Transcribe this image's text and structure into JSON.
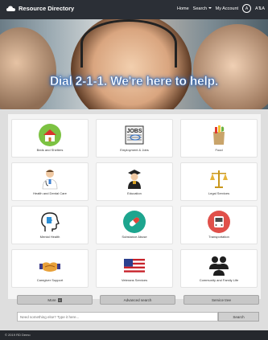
{
  "navbar": {
    "brand": "Resource Directory",
    "home": "Home",
    "search": "Search",
    "account": "My Account",
    "accessibility_text": "A",
    "font_size_text": "A⇅A"
  },
  "hero": {
    "title": "Dial 2-1-1. We're here to help."
  },
  "categories": [
    {
      "label": "Beds and Shelters",
      "icon": "house-icon"
    },
    {
      "label": "Employment & Jobs",
      "icon": "jobs-newspaper-icon"
    },
    {
      "label": "Food",
      "icon": "grocery-bag-icon"
    },
    {
      "label": "Health and Dental Care",
      "icon": "doctor-icon"
    },
    {
      "label": "Education",
      "icon": "graduate-icon"
    },
    {
      "label": "Legal Services",
      "icon": "scales-icon"
    },
    {
      "label": "Mental Health",
      "icon": "head-puzzle-icon"
    },
    {
      "label": "Substance Abuse",
      "icon": "pill-icon"
    },
    {
      "label": "Transportation",
      "icon": "bus-icon"
    },
    {
      "label": "Caregiver Support",
      "icon": "handshake-icon"
    },
    {
      "label": "Veterans Services",
      "icon": "us-flag-icon"
    },
    {
      "label": "Community and Family Life",
      "icon": "people-icon"
    }
  ],
  "buttons": {
    "more": "More",
    "more_badge": "+",
    "advanced": "Advanced search",
    "service_tree": "Service tree"
  },
  "search": {
    "placeholder": "Need something else? Type it here...",
    "button": "Search"
  },
  "footer": {
    "text": "© 2019 RD Demo"
  },
  "colors": {
    "navbar": "#2b2f36",
    "panel": "#f4f4f4",
    "hero_text_glow": "#2d63b0"
  }
}
